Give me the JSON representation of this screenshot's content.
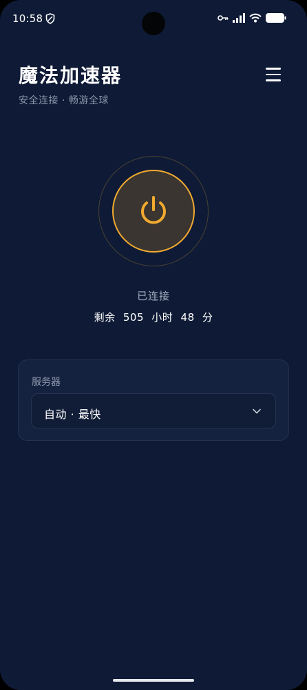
{
  "status_bar": {
    "time": "10:58",
    "icons": [
      "shield-icon",
      "vpn-key-icon",
      "signal-icon",
      "wifi-icon",
      "battery-icon"
    ]
  },
  "header": {
    "title": "魔法加速器",
    "subtitle": "安全连接 · 畅游全球",
    "menu_icon": "hamburger-menu-icon"
  },
  "connection": {
    "status": "已连接",
    "remaining": "剩余 505 小时 48 分",
    "power_icon": "power-icon"
  },
  "server": {
    "label": "服务器",
    "selected": "自动 · 最快",
    "dropdown_icon": "chevron-down-icon"
  },
  "colors": {
    "background": "#0f1b36",
    "accent": "#f2aa2f",
    "card": "#15223f",
    "muted_text": "#8e98ac"
  }
}
